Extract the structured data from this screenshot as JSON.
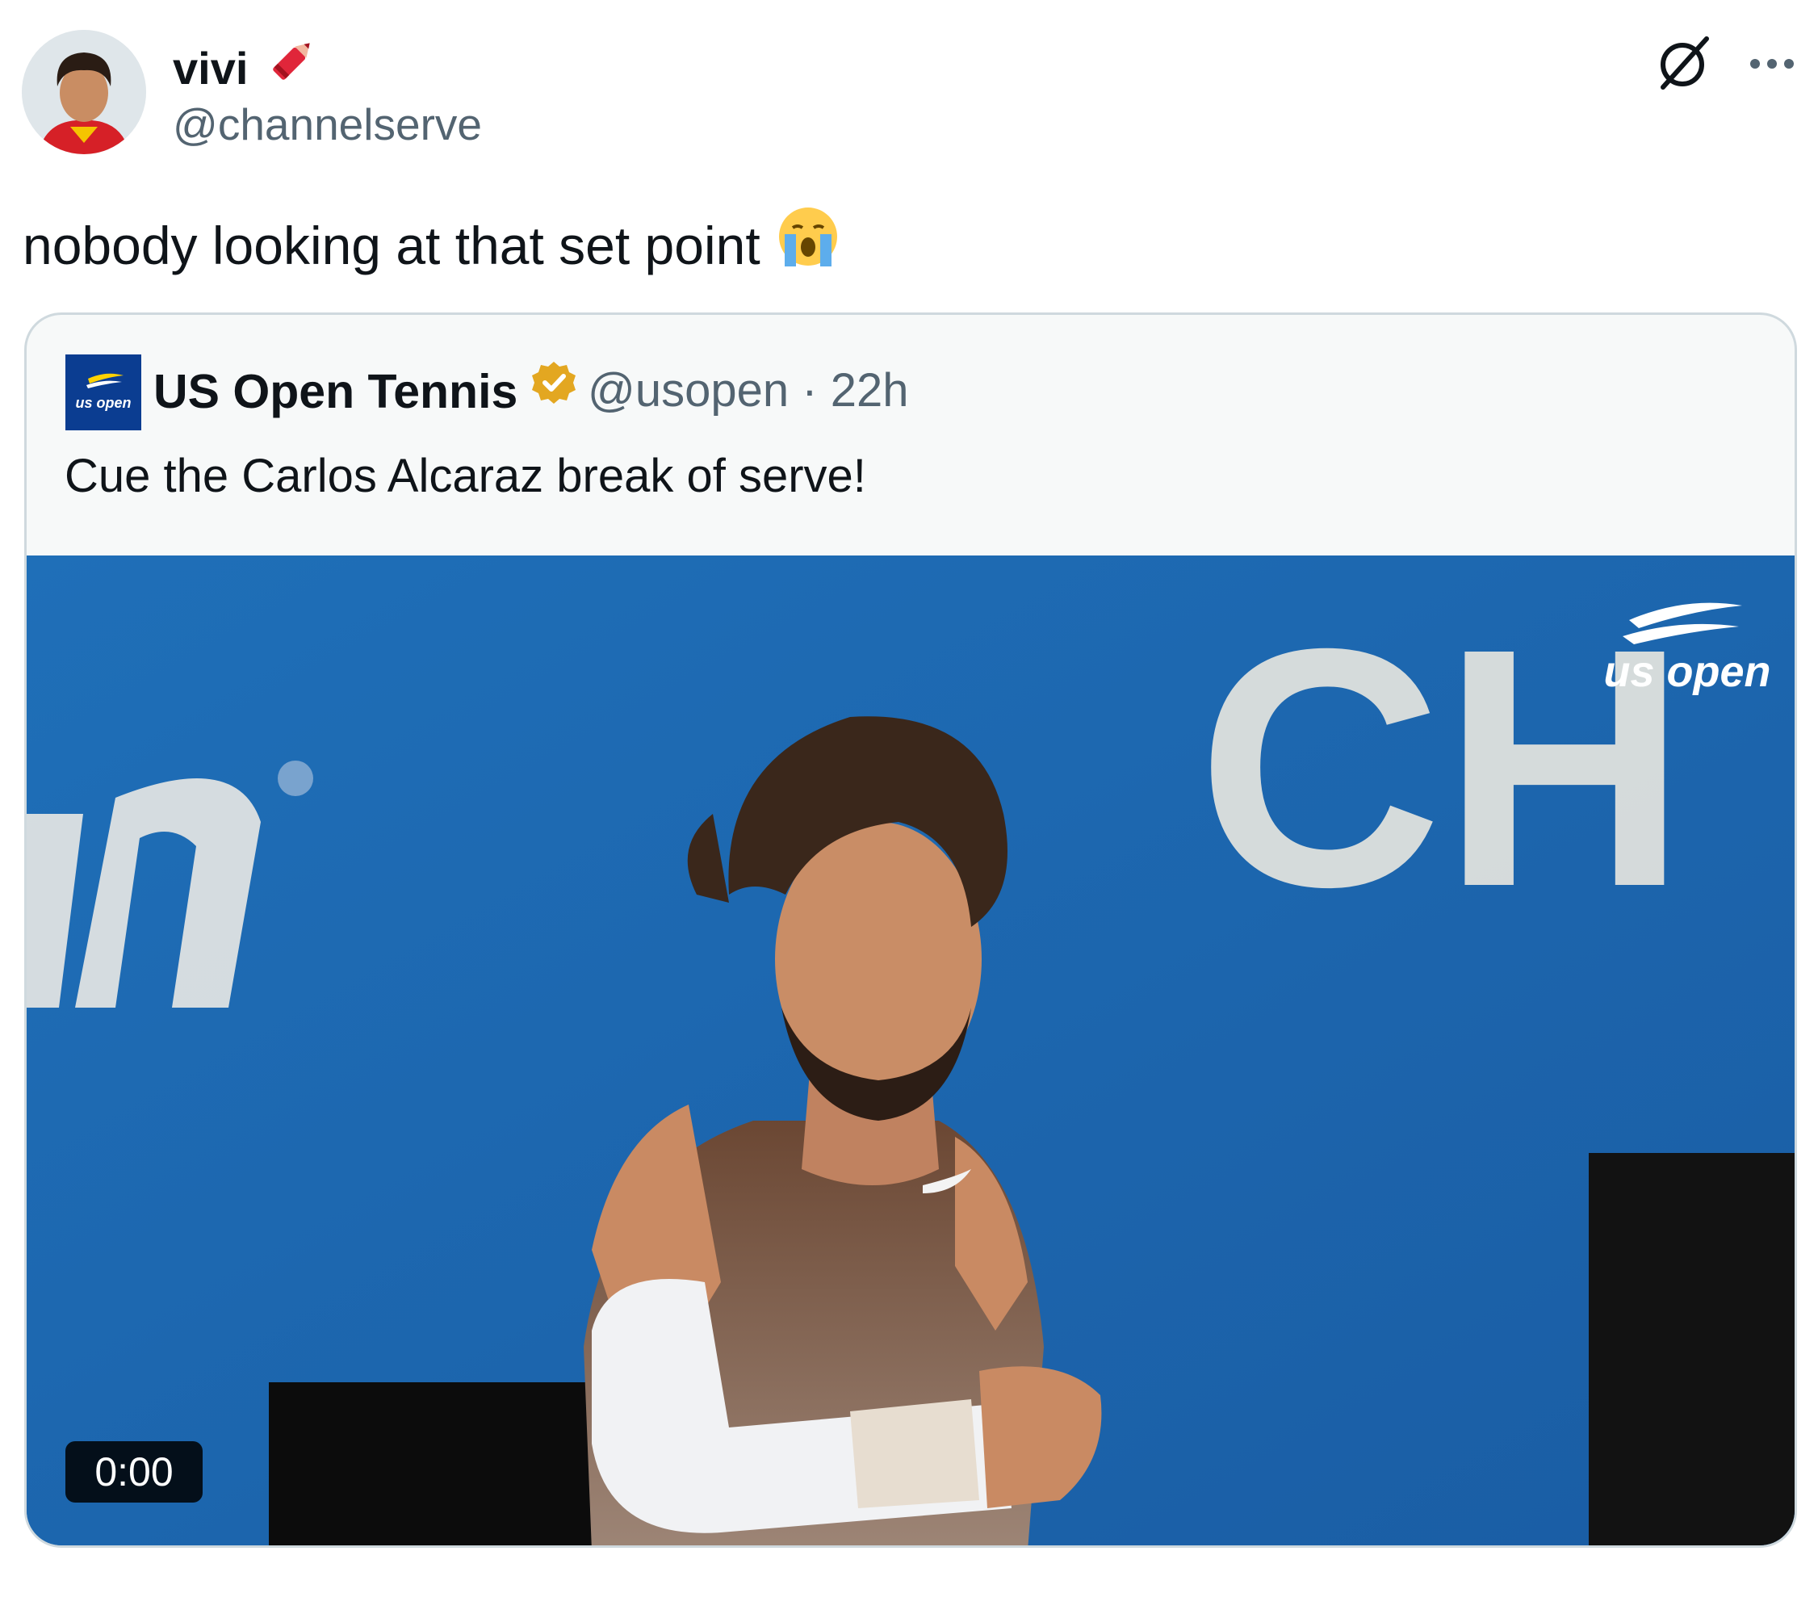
{
  "tweet": {
    "author_name": "vivi",
    "author_handle": "@channelserve",
    "text": "nobody looking at that set point",
    "name_emoji_icon": "crayon-icon",
    "text_emoji_icon": "crying-face-icon"
  },
  "actions": {
    "grok_icon": "grok-icon",
    "more_icon": "more-icon"
  },
  "quote": {
    "author_name": "US Open Tennis",
    "author_handle": "@usopen",
    "separator": "·",
    "time": "22h",
    "text": "Cue the Carlos Alcaraz break of serve!",
    "logo_text": "us open",
    "verified_icon": "verified-badge-icon"
  },
  "video": {
    "timestamp": "0:00",
    "watermark": "us open",
    "board_letters": "CH"
  },
  "colors": {
    "text_primary": "#0f1419",
    "text_secondary": "#536471",
    "card_border": "#cfd9de",
    "card_bg": "#f7f9f9",
    "court_blue": "#1c67b0",
    "verified_gold": "#e3a721"
  }
}
